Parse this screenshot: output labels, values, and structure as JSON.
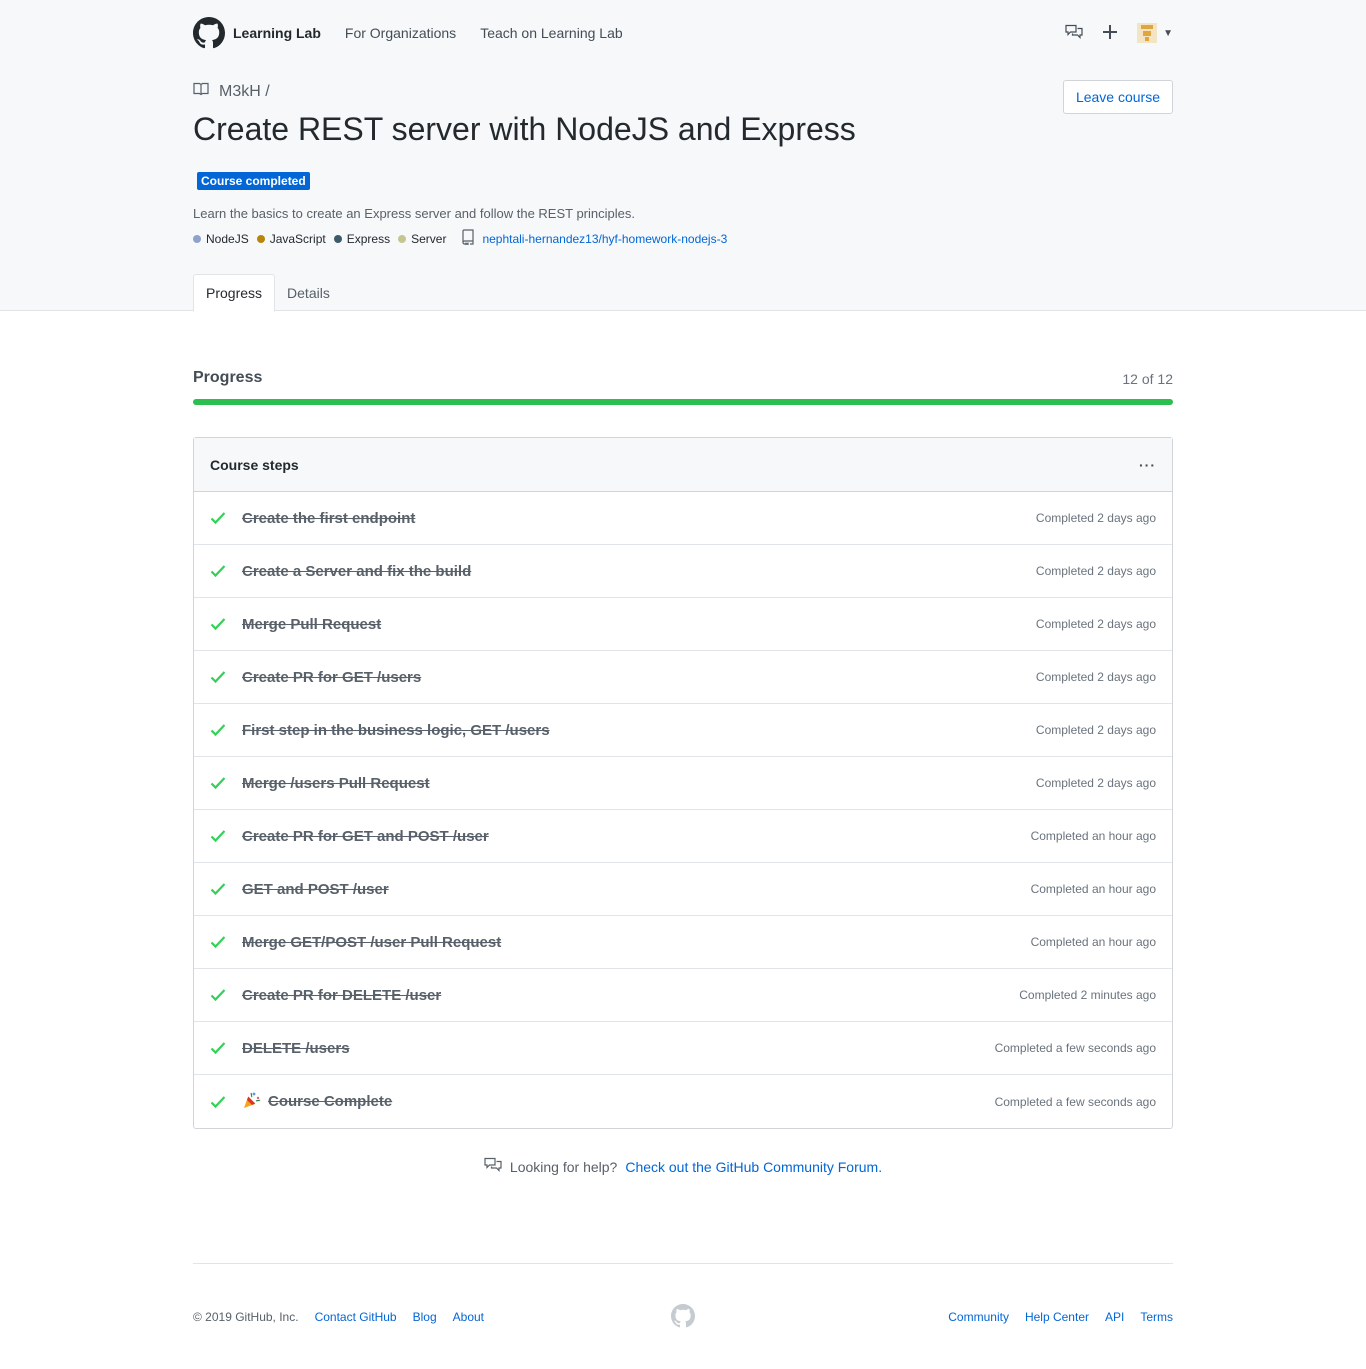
{
  "nav": {
    "brand": "Learning Lab",
    "links": [
      "For Organizations",
      "Teach on Learning Lab"
    ]
  },
  "course": {
    "owner": "M3kH /",
    "title": "Create REST server with NodeJS and Express",
    "badge": "Course completed",
    "description": "Learn the basics to create an Express server and follow the REST principles.",
    "leave_label": "Leave course",
    "tags": [
      {
        "name": "NodeJS",
        "color": "#8fa2cc"
      },
      {
        "name": "JavaScript",
        "color": "#b8860b"
      },
      {
        "name": "Express",
        "color": "#3d5a6c"
      },
      {
        "name": "Server",
        "color": "#c5c592"
      }
    ],
    "repo": "nephtali-hernandez13/hyf-homework-nodejs-3"
  },
  "tabs": [
    "Progress",
    "Details"
  ],
  "progress": {
    "title": "Progress",
    "count": "12 of 12",
    "fraction": 1.0
  },
  "steps_box": {
    "title": "Course steps",
    "menu": "···",
    "steps": [
      {
        "name": "Create the first endpoint",
        "when": "Completed 2 days ago"
      },
      {
        "name": "Create a Server and fix the build",
        "when": "Completed 2 days ago"
      },
      {
        "name": "Merge Pull Request",
        "when": "Completed 2 days ago"
      },
      {
        "name": "Create PR for GET /users",
        "when": "Completed 2 days ago"
      },
      {
        "name": "First step in the business logic, GET /users",
        "when": "Completed 2 days ago"
      },
      {
        "name": "Merge /users Pull Request",
        "when": "Completed 2 days ago"
      },
      {
        "name": "Create PR for GET and POST /user",
        "when": "Completed an hour ago"
      },
      {
        "name": "GET and POST /user",
        "when": "Completed an hour ago"
      },
      {
        "name": "Merge GET/POST /user Pull Request",
        "when": "Completed an hour ago"
      },
      {
        "name": "Create PR for DELETE /user",
        "when": "Completed 2 minutes ago"
      },
      {
        "name": "DELETE /users",
        "when": "Completed a few seconds ago"
      },
      {
        "name": "Course Complete",
        "when": "Completed a few seconds ago"
      }
    ]
  },
  "help": {
    "text": "Looking for help?",
    "link": "Check out the GitHub Community Forum."
  },
  "footer": {
    "copyright": "© 2019 GitHub, Inc.",
    "left_links": [
      "Contact GitHub",
      "Blog",
      "About"
    ],
    "right_links": [
      "Community",
      "Help Center",
      "API",
      "Terms"
    ]
  }
}
